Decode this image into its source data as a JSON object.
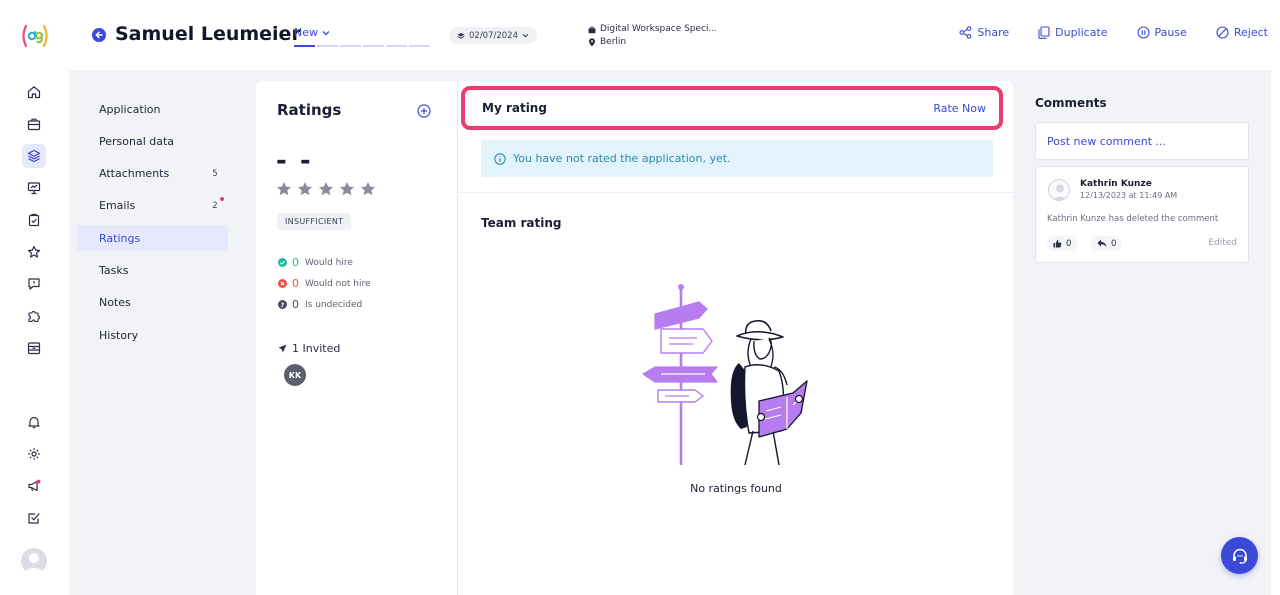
{
  "header": {
    "candidate_name": "Samuel Leumeier",
    "status_label": "New",
    "date": "02/07/2024",
    "job_title": "Digital Workspace Speci...",
    "location": "Berlin",
    "actions": [
      "Share",
      "Duplicate",
      "Pause",
      "Reject"
    ]
  },
  "colors": {
    "accent": "#3b4ad6",
    "highlight": "#ea3d6f",
    "info_bg": "#e2f3fb",
    "would_hire": "#21b8a0",
    "would_not_hire": "#e5544b"
  },
  "rail_icons": [
    "home-icon",
    "briefcase-icon",
    "layers-icon",
    "presentation-icon",
    "clipboard-check-icon",
    "star-icon",
    "message-icon",
    "puzzle-icon",
    "archive-icon",
    "bell-icon",
    "gear-icon",
    "megaphone-icon",
    "checkbox-icon"
  ],
  "section_nav": {
    "items": [
      {
        "label": "Application"
      },
      {
        "label": "Personal data"
      },
      {
        "label": "Attachments",
        "badge": "5"
      },
      {
        "label": "Emails",
        "badge": "2"
      },
      {
        "label": "Ratings"
      },
      {
        "label": "Tasks"
      },
      {
        "label": "Notes"
      },
      {
        "label": "History"
      }
    ],
    "active": "Ratings"
  },
  "ratings": {
    "title": "Ratings",
    "score": "- -",
    "stars_filled": 0,
    "stars_total": 5,
    "level": "INSUFFICIENT",
    "verdicts": [
      {
        "count": "0",
        "label": "Would hire"
      },
      {
        "count": "0",
        "label": "Would not hire"
      },
      {
        "count": "0",
        "label": "Is undecided"
      }
    ],
    "invited_label": "1 Invited",
    "invited_initials": "KK"
  },
  "my_rating": {
    "title": "My rating",
    "action": "Rate Now",
    "info": "You have not rated the application, yet."
  },
  "team_rating": {
    "title": "Team rating",
    "empty": "No ratings found"
  },
  "comments": {
    "title": "Comments",
    "placeholder": "Post new comment ...",
    "items": [
      {
        "author": "Kathrin Kunze",
        "date": "12/13/2023 at 11:49 AM",
        "text": "Kathrin Kunze has deleted the comment",
        "likes": "0",
        "replies": "0",
        "status": "Edited"
      }
    ]
  }
}
